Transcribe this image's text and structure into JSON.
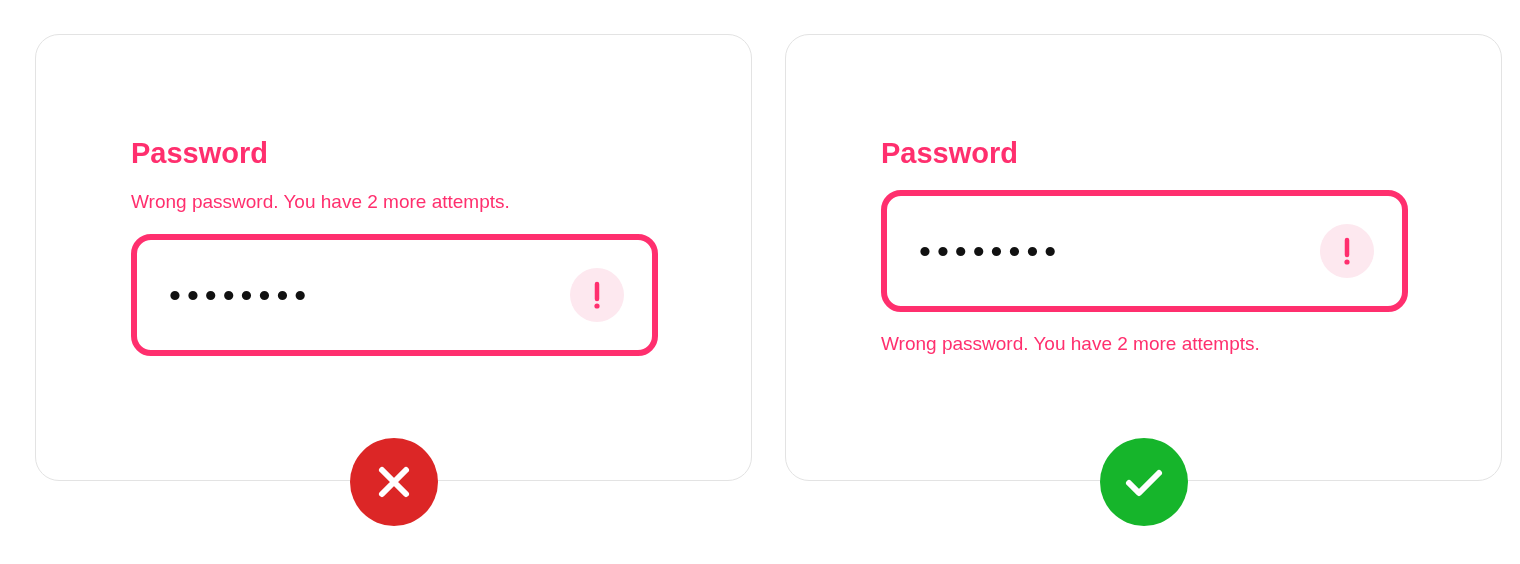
{
  "examples": [
    {
      "kind": "above",
      "label": "Password",
      "message": "Wrong password. You have 2 more attempts.",
      "value": "••••••••",
      "badge": {
        "kind": "cross"
      }
    },
    {
      "kind": "below",
      "label": "Password",
      "message": "Wrong password. You have 2 more attempts.",
      "value": "••••••••",
      "badge": {
        "kind": "check"
      }
    }
  ]
}
